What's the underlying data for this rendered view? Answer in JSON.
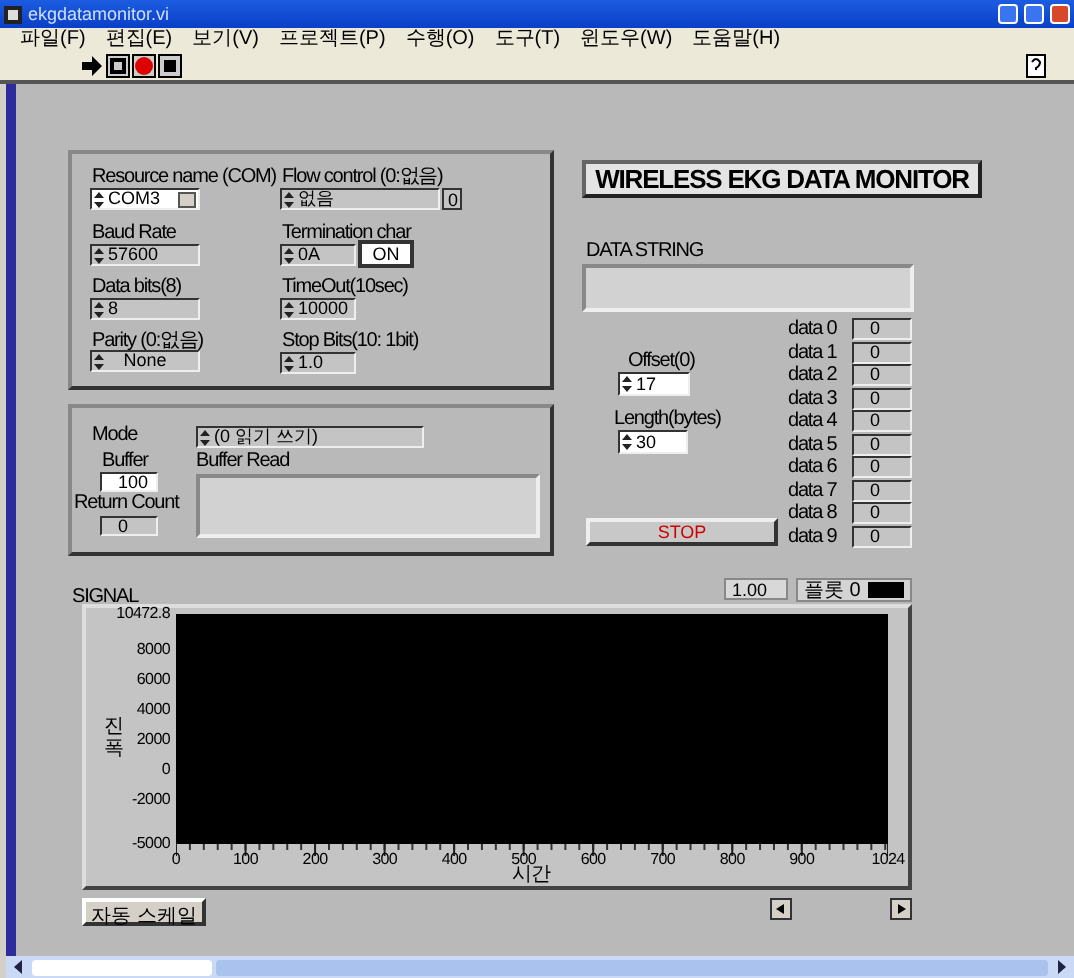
{
  "window": {
    "title": "ekgdatamonitor.vi"
  },
  "menu": [
    {
      "label": "파일(F)"
    },
    {
      "label": "편집(E)"
    },
    {
      "label": "보기(V)"
    },
    {
      "label": "프로젝트(P)"
    },
    {
      "label": "수행(O)"
    },
    {
      "label": "도구(T)"
    },
    {
      "label": "윈도우(W)"
    },
    {
      "label": "도움말(H)"
    }
  ],
  "serial_settings": [
    {
      "label": "Resource name (COM)",
      "value": "COM3",
      "kind": "dropdown"
    },
    {
      "label": "Flow control (0:없음)",
      "value": "없음",
      "kind": "indicator",
      "indicator": "0"
    },
    {
      "label": "Baud Rate",
      "value": "57600",
      "kind": "numeric"
    },
    {
      "label": "Termination char",
      "value": "0A",
      "kind": "toggle",
      "toggle": {
        "label": "ON",
        "on": true
      }
    },
    {
      "label": "Data bits(8)",
      "value": "8",
      "kind": "numeric"
    },
    {
      "label": "TimeOut(10sec)",
      "value": "10000",
      "kind": "numeric"
    },
    {
      "label": "Parity (0:없음)",
      "value": "None",
      "kind": "ring"
    },
    {
      "label": "Stop Bits(10: 1bit)",
      "value": "1.0",
      "kind": "numeric"
    }
  ],
  "read_settings": {
    "mode": {
      "label": "Mode",
      "value": "(0 읽기 쓰기)"
    },
    "buffer": {
      "label": "Buffer",
      "value": "100"
    },
    "return_count": {
      "label": "Return Count",
      "value": "0"
    },
    "buffer_read": {
      "label": "Buffer Read"
    }
  },
  "heading": "WIRELESS EKG DATA MONITOR",
  "data_string": {
    "label": "DATA STRING"
  },
  "offset": {
    "label": "Offset(0)",
    "value": "17"
  },
  "length": {
    "label": "Length(bytes)",
    "value": "30"
  },
  "data_fields": [
    {
      "label": "data 0",
      "value": "0"
    },
    {
      "label": "data 1",
      "value": "0"
    },
    {
      "label": "data 2",
      "value": "0"
    },
    {
      "label": "data 3",
      "value": "0"
    },
    {
      "label": "data 4",
      "value": "0"
    },
    {
      "label": "data 5",
      "value": "0"
    },
    {
      "label": "data 6",
      "value": "0"
    },
    {
      "label": "data 7",
      "value": "0"
    },
    {
      "label": "data 8",
      "value": "0"
    },
    {
      "label": "data 9",
      "value": "0"
    }
  ],
  "stop_button": "STOP",
  "signal": {
    "label": "SIGNAL",
    "legend_value": "1.00",
    "plot_name": "플롯 0",
    "tool_button": "자동 스케일",
    "chart_data": {
      "type": "line",
      "xlabel": "시간",
      "ylabel": "진폭",
      "xlim": [
        0,
        1024
      ],
      "ylim": [
        -5000,
        10472.8
      ],
      "xticks": [
        0,
        100,
        200,
        300,
        400,
        500,
        600,
        700,
        800,
        900,
        1024
      ],
      "yticks": [
        {
          "value": 10472.8,
          "label": "10472.8"
        },
        8000,
        6000,
        4000,
        2000,
        0,
        -2000,
        -5000
      ]
    }
  }
}
